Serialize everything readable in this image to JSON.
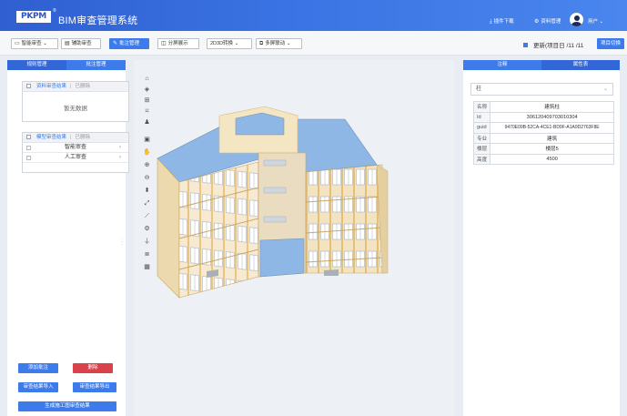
{
  "header": {
    "logo_text": "PKPM",
    "logo_mark": "®",
    "app_title": "BIM审查管理系统",
    "download_label": "插件下载",
    "data_mgmt_label": "资料管理",
    "user_label": "用户"
  },
  "toolbar": {
    "buttons": [
      {
        "label": "智能审查",
        "icon": "monitor-icon",
        "dropdown": true
      },
      {
        "label": "辅助审查",
        "icon": "clipboard-icon",
        "dropdown": false
      },
      {
        "label": "批注管理",
        "icon": "note-icon",
        "dropdown": false,
        "active": true
      },
      {
        "label": "分屏展示",
        "icon": "split-screen-icon",
        "dropdown": false
      },
      {
        "label": "2D3D转换",
        "icon": "",
        "dropdown": true
      },
      {
        "label": "多屏联动",
        "icon": "multi-screen-icon",
        "dropdown": true
      }
    ],
    "project_info": "更新(项目日 /11 /11",
    "switch_label": "项目切换"
  },
  "left_panel": {
    "tabs": [
      "规则管理",
      "批注管理"
    ],
    "section1": {
      "title": "资料审查结果",
      "delete": "已删除",
      "empty": "暂无数据"
    },
    "section2": {
      "title": "模型审查结果",
      "delete": "已删除",
      "rows": [
        "智能审查",
        "人工审查"
      ]
    },
    "buttons": {
      "add": "添加批注",
      "delete": "删除",
      "import": "审查结果导入",
      "export": "审查结果导出",
      "generate": "生成施工图审查结果"
    }
  },
  "viewport": {
    "tool_icons": [
      "home-icon",
      "cube-view-icon",
      "grid-icon",
      "fit-icon",
      "pedestrian-icon",
      "section-box-icon",
      "hand-pan-icon",
      "zoom-in-icon",
      "zoom-out-icon",
      "clip-icon",
      "fullscreen-icon",
      "measure-icon",
      "settings-icon",
      "filter-icon",
      "layers-icon",
      "properties-icon"
    ]
  },
  "right_panel": {
    "tabs": [
      "注释",
      "属性表"
    ],
    "select_value": "柱",
    "properties": [
      {
        "key": "名称",
        "value": "建筑柱"
      },
      {
        "key": "Id",
        "value": "306120409703010304"
      },
      {
        "key": "guid",
        "value": "9470E09B-52CA-4CE1-BD9F-A1A9D2763F8E"
      },
      {
        "key": "专业",
        "value": "建筑"
      },
      {
        "key": "楼层",
        "value": "楼层5"
      },
      {
        "key": "高度",
        "value": "4500"
      }
    ]
  },
  "colors": {
    "primary": "#3d7bea",
    "header": "#3a73e3",
    "danger": "#d9414b",
    "roof": "#8fb7e6",
    "wall": "#f4e6c3",
    "column": "#e7c98c"
  }
}
